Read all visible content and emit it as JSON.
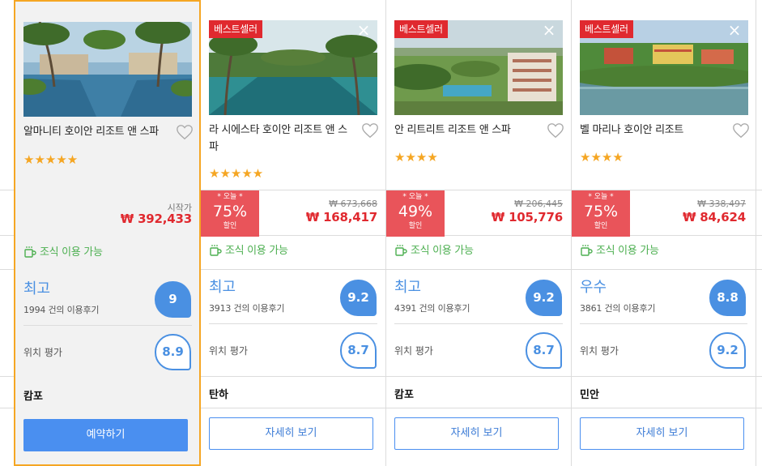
{
  "hotels": [
    {
      "name": "알마니티 호이안 리조트 앤 스파",
      "badge": "",
      "stars": "★★★★★",
      "start_label": "시작가",
      "original_price": "",
      "price": "₩ 392,433",
      "discount": null,
      "breakfast": "조식 이용 가능",
      "rating_word": "최고",
      "review_count": "1994 건의 이용후기",
      "score": "9",
      "location_label": "위치 평가",
      "location_score": "8.9",
      "area": "캄포",
      "button": "예약하기",
      "selected": true
    },
    {
      "name": "라 시에스타 호이안 리조트 앤 스파",
      "badge": "베스트셀러",
      "stars": "★★★★★",
      "start_label": "",
      "original_price": "₩ 673,668",
      "price": "₩ 168,417",
      "discount": {
        "today": "* 오늘 *",
        "percent": "75%",
        "off": "할인"
      },
      "breakfast": "조식 이용 가능",
      "rating_word": "최고",
      "review_count": "3913 건의 이용후기",
      "score": "9.2",
      "location_label": "위치 평가",
      "location_score": "8.7",
      "area": "탄하",
      "button": "자세히 보기",
      "selected": false
    },
    {
      "name": "안 리트리트 리조트 앤 스파",
      "badge": "베스트셀러",
      "stars": "★★★★",
      "start_label": "",
      "original_price": "₩ 206,445",
      "price": "₩ 105,776",
      "discount": {
        "today": "* 오늘 *",
        "percent": "49%",
        "off": "할인"
      },
      "breakfast": "조식 이용 가능",
      "rating_word": "최고",
      "review_count": "4391 건의 이용후기",
      "score": "9.2",
      "location_label": "위치 평가",
      "location_score": "8.7",
      "area": "캄포",
      "button": "자세히 보기",
      "selected": false
    },
    {
      "name": "벨 마리나 호이안 리조트",
      "badge": "베스트셀러",
      "stars": "★★★★",
      "start_label": "",
      "original_price": "₩ 338,497",
      "price": "₩ 84,624",
      "discount": {
        "today": "* 오늘 *",
        "percent": "75%",
        "off": "할인"
      },
      "breakfast": "조식 이용 가능",
      "rating_word": "우수",
      "review_count": "3861 건의 이용후기",
      "score": "8.8",
      "location_label": "위치 평가",
      "location_score": "9.2",
      "area": "민안",
      "button": "자세히 보기",
      "selected": false
    }
  ],
  "colors": {
    "accent": "#4a90e2",
    "selected_border": "#f5a623",
    "price": "#e0292f",
    "discount_bg": "#e9545a",
    "breakfast": "#4caf50",
    "star": "#f5a623"
  }
}
